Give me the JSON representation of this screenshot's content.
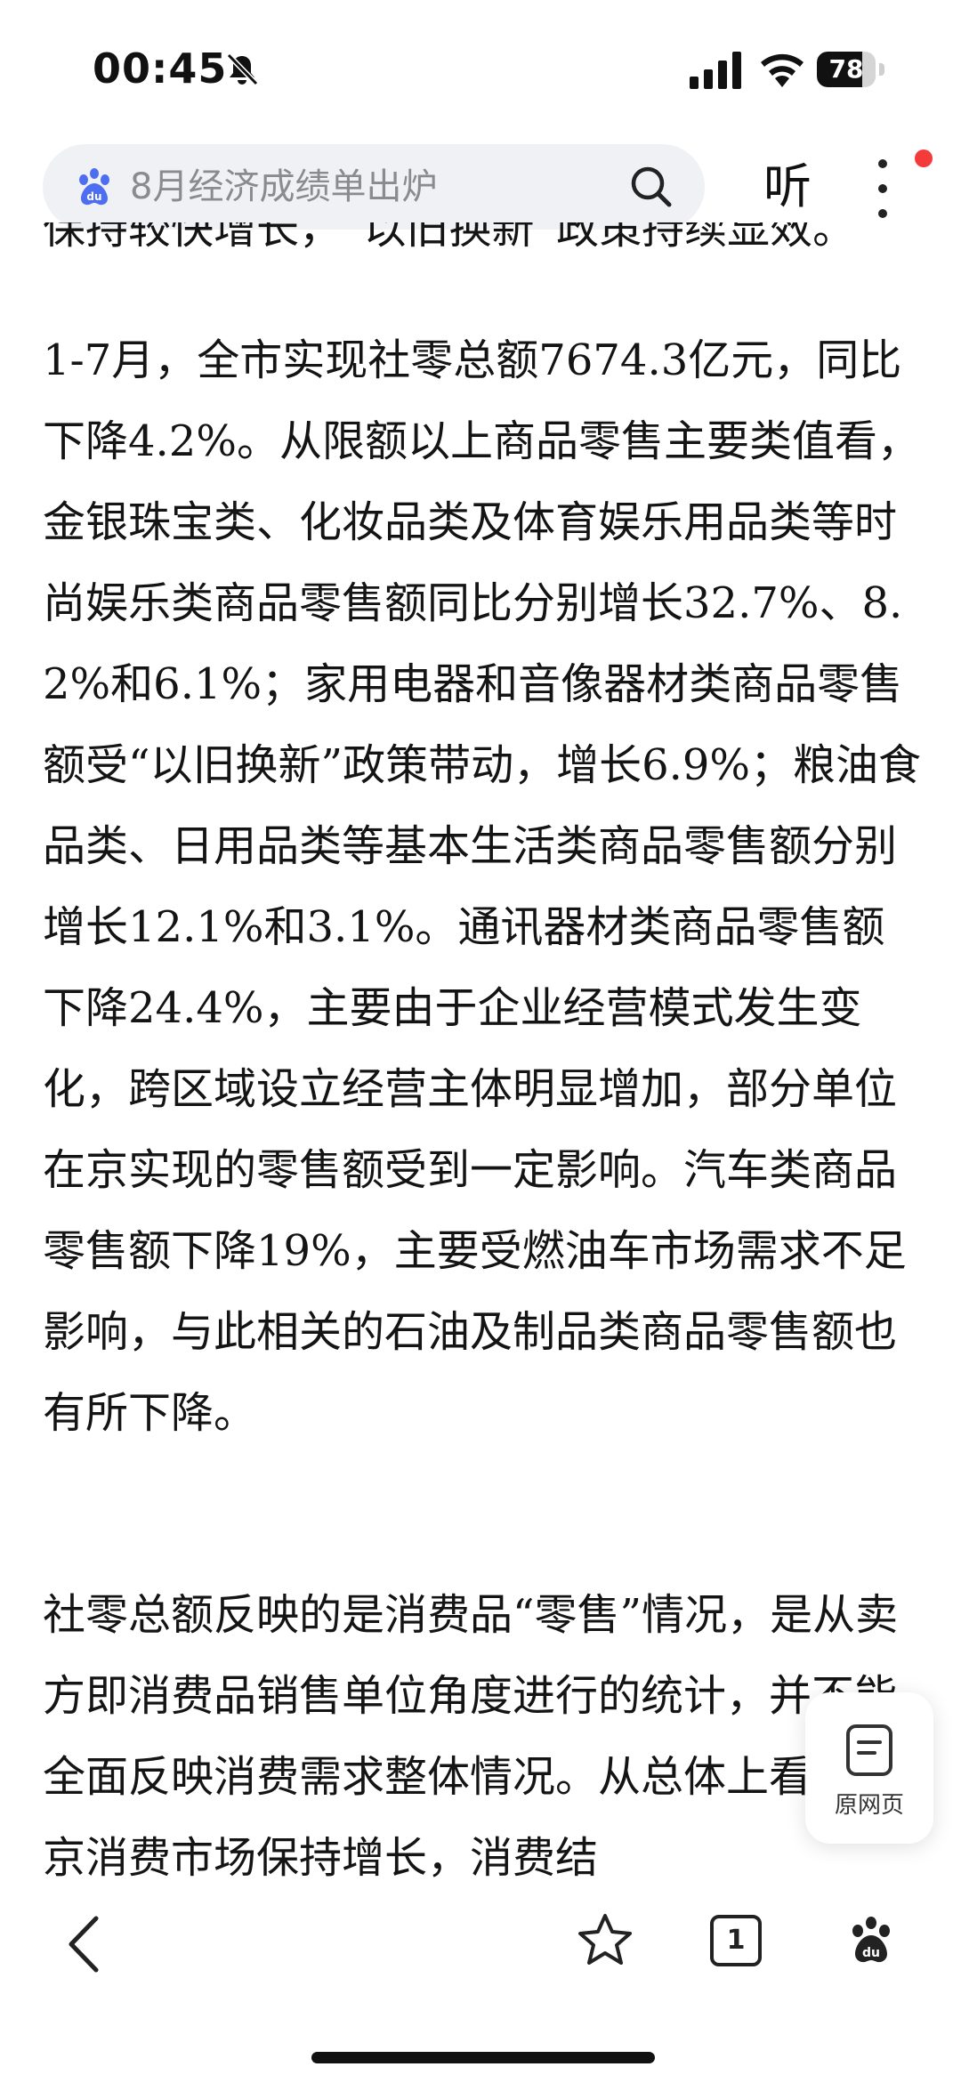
{
  "status_bar": {
    "time": "00:45",
    "battery": "78",
    "battery_level": 0.78
  },
  "header": {
    "search_text": "8月经济成绩单出炉",
    "listen_label": "听"
  },
  "article": {
    "fragment_top": "保持较快增长，“以旧换新”政策持续显效。",
    "paragraph_1": "1-7月，全市实现社零总额7674.3亿元，同比下降4.2%。从限额以上商品零售主要类值看，金银珠宝类、化妆品类及体育娱乐用品类等时尚娱乐类商品零售额同比分别增长32.7%、8.2%和6.1%；家用电器和音像器材类商品零售额受“以旧换新”政策带动，增长6.9%；粮油食品类、日用品类等基本生活类商品零售额分别增长12.1%和3.1%。通讯器材类商品零售额下降24.4%，主要由于企业经营模式发生变化，跨区域设立经营主体明显增加，部分单位在京实现的零售额受到一定影响。汽车类商品零售额下降19%，主要受燃油车市场需求不足影响，与此相关的石油及制品类商品零售额也有所下降。",
    "paragraph_2": "社零总额反映的是消费品“零售”情况，是从卖方即消费品销售单位角度进行的统计，并不能全面反映消费需求整体情况。从总体上看，北京消费市场保持增长，消费结"
  },
  "floating": {
    "original_page_label": "原网页"
  },
  "toolbar": {
    "tab_count": "1"
  }
}
